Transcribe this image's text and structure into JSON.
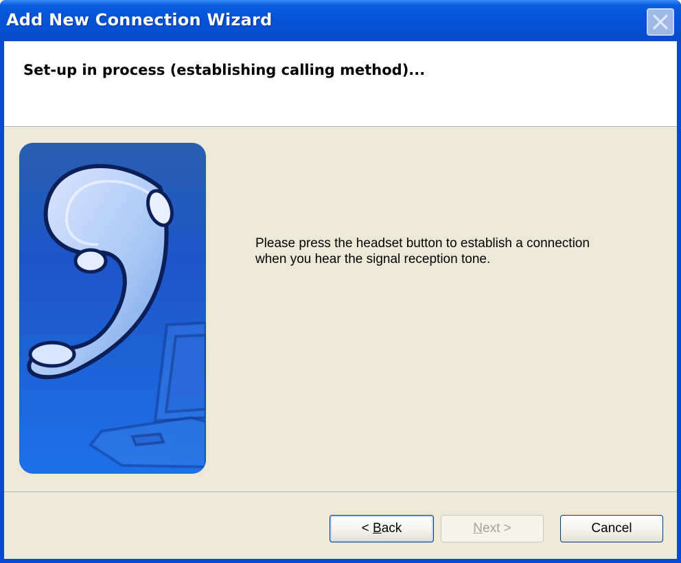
{
  "window": {
    "title": "Add New Connection Wizard"
  },
  "header": {
    "title": "Set-up in process (establishing calling method)..."
  },
  "content": {
    "message_line1": "Please press the headset button to establish a connection",
    "message_line2": "when you hear the signal reception tone."
  },
  "buttons": {
    "back": {
      "prefix": "< ",
      "mnemonic": "B",
      "rest": "ack"
    },
    "next": {
      "mnemonic": "N",
      "rest": "ext",
      "suffix": " >",
      "enabled": false
    },
    "cancel": "Cancel"
  },
  "icons": {
    "close": "close-icon",
    "illustration": "headset-laptop-illustration"
  },
  "colors": {
    "titlebar": "#0654d8",
    "dialog_background": "#ece9d8",
    "illustration_blue": "#1f5fd8"
  }
}
